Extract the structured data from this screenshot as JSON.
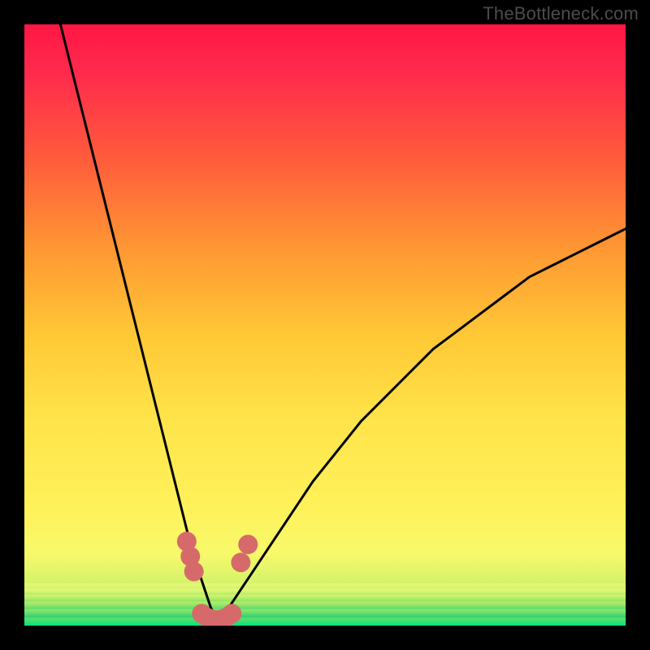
{
  "watermark": "TheBottleneck.com",
  "chart_data": {
    "type": "line",
    "title": "",
    "xlabel": "",
    "ylabel": "",
    "xlim": [
      0,
      100
    ],
    "ylim": [
      0,
      100
    ],
    "background_gradient": {
      "top_color": "#ff1744",
      "upper_mid_color": "#ff7a36",
      "mid_color": "#ffd83a",
      "lower_mid_color": "#fcf45a",
      "green_band_top": "#9df06a",
      "green_band_bottom": "#00e676"
    },
    "green_zone_y": [
      0,
      7
    ],
    "curve_vertex_x": 32,
    "series": [
      {
        "name": "left-branch",
        "x": [
          6,
          8,
          10,
          12,
          14,
          16,
          18,
          20,
          22,
          24,
          26,
          27,
          28,
          29,
          30,
          31,
          32
        ],
        "y": [
          100,
          92,
          84,
          76,
          68,
          60,
          52,
          44,
          36,
          28,
          20,
          16,
          12,
          9,
          6,
          3,
          1
        ]
      },
      {
        "name": "right-branch",
        "x": [
          32,
          34,
          36,
          38,
          40,
          44,
          48,
          52,
          56,
          60,
          64,
          68,
          72,
          76,
          80,
          84,
          88,
          92,
          96,
          100
        ],
        "y": [
          1,
          3,
          6,
          9,
          12,
          18,
          24,
          29,
          34,
          38,
          42,
          46,
          49,
          52,
          55,
          58,
          60,
          62,
          64,
          66
        ]
      }
    ],
    "markers": [
      {
        "name": "left-marker-a",
        "x": 27.0,
        "y": 14.0
      },
      {
        "name": "left-marker-b",
        "x": 27.6,
        "y": 11.5
      },
      {
        "name": "left-marker-c",
        "x": 28.2,
        "y": 9.0
      },
      {
        "name": "right-marker-a",
        "x": 36.0,
        "y": 10.5
      },
      {
        "name": "right-marker-b",
        "x": 37.2,
        "y": 13.5
      },
      {
        "name": "bottom-a",
        "x": 29.5,
        "y": 2.0
      },
      {
        "name": "bottom-b",
        "x": 30.5,
        "y": 1.3
      },
      {
        "name": "bottom-c",
        "x": 31.5,
        "y": 1.0
      },
      {
        "name": "bottom-d",
        "x": 32.5,
        "y": 1.0
      },
      {
        "name": "bottom-e",
        "x": 33.5,
        "y": 1.3
      },
      {
        "name": "bottom-f",
        "x": 34.5,
        "y": 2.0
      }
    ],
    "marker_color": "#d66a6a",
    "marker_radius": 12,
    "curve_color": "#000000"
  }
}
